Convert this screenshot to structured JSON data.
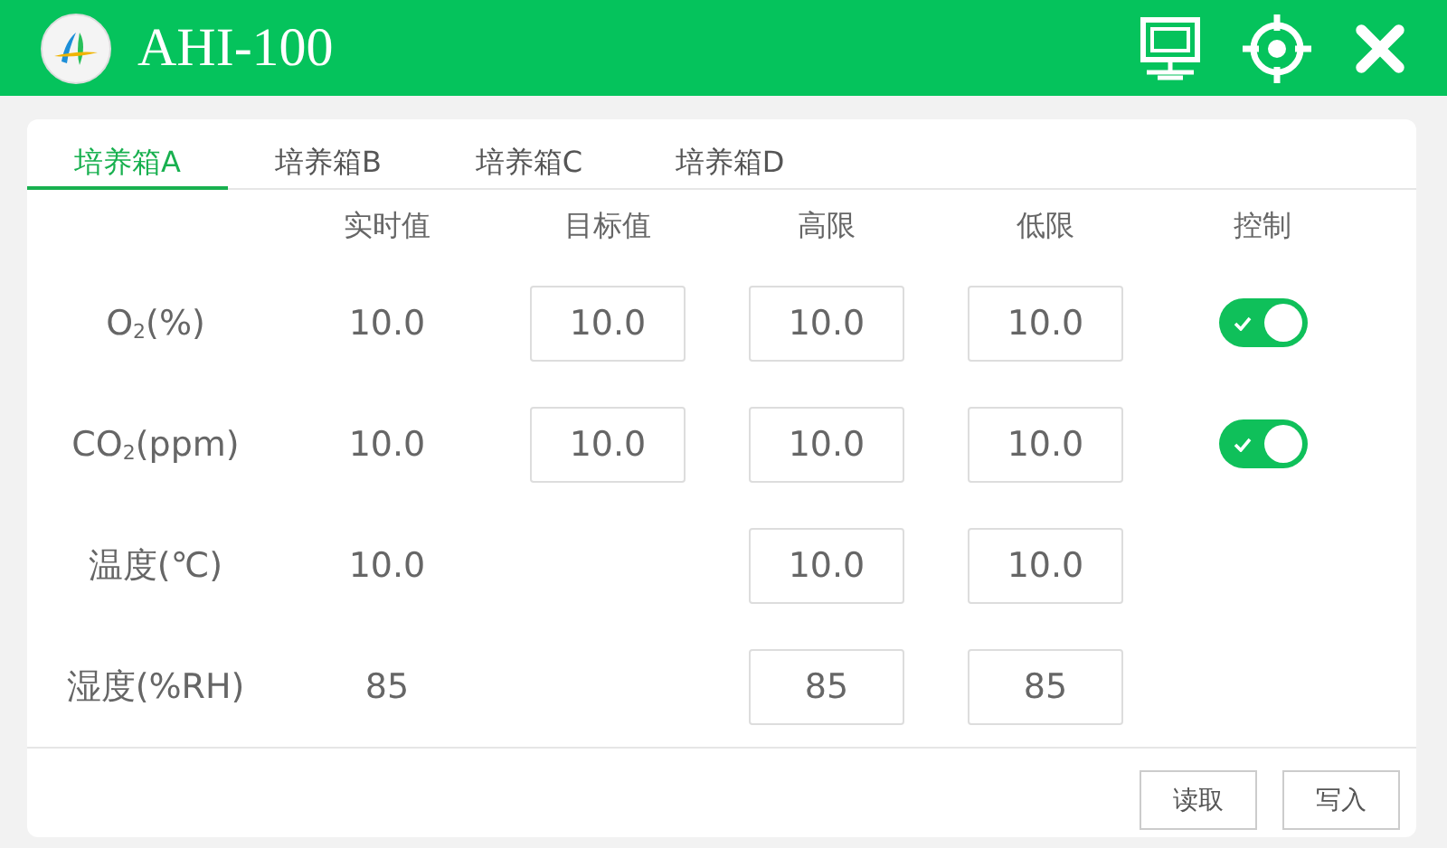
{
  "window": {
    "title": "AHI-100"
  },
  "tabs": [
    {
      "label": "培养箱A",
      "selected": true
    },
    {
      "label": "培养箱B",
      "selected": false
    },
    {
      "label": "培养箱C",
      "selected": false
    },
    {
      "label": "培养箱D",
      "selected": false
    }
  ],
  "table": {
    "columns": [
      "实时值",
      "目标值",
      "高限",
      "低限",
      "控制"
    ],
    "rows": [
      {
        "label": "O$_{2}$(%)",
        "realtime": "10.0",
        "target": "10.0",
        "high": "10.0",
        "low": "10.0",
        "control": {
          "on": true
        }
      },
      {
        "label": "CO$_{2}$(ppm)",
        "realtime": "10.0",
        "target": "10.0",
        "high": "10.0",
        "low": "10.0",
        "control": {
          "on": true
        }
      },
      {
        "label": "温度(℃)",
        "realtime": "10.0",
        "high": "10.0",
        "low": "10.0"
      },
      {
        "label": "湿度(%RH)",
        "realtime": "85",
        "high": "85",
        "low": "85"
      }
    ]
  },
  "buttons": [
    "读取",
    "写入"
  ]
}
